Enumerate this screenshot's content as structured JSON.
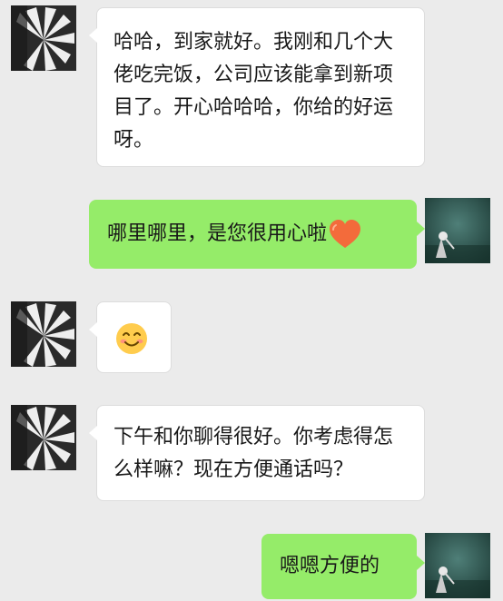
{
  "chat": {
    "messages": [
      {
        "sender": "contact",
        "text": "哈哈，到家就好。我刚和几个大佬吃完饭，公司应该能拿到新项目了。开心哈哈哈，你给的好运呀。"
      },
      {
        "sender": "me",
        "text": "哪里哪里，是您很用心啦",
        "emoji": "heart-emoji"
      },
      {
        "sender": "contact",
        "emoji": "smile-emoji"
      },
      {
        "sender": "contact",
        "text": "下午和你聊得很好。你考虑得怎么样嘛？现在方便通话吗？"
      },
      {
        "sender": "me",
        "text": "嗯嗯方便的"
      }
    ]
  },
  "colors": {
    "background": "#ebebeb",
    "bubble_received": "#ffffff",
    "bubble_sent": "#95ec69",
    "text": "#191919"
  }
}
